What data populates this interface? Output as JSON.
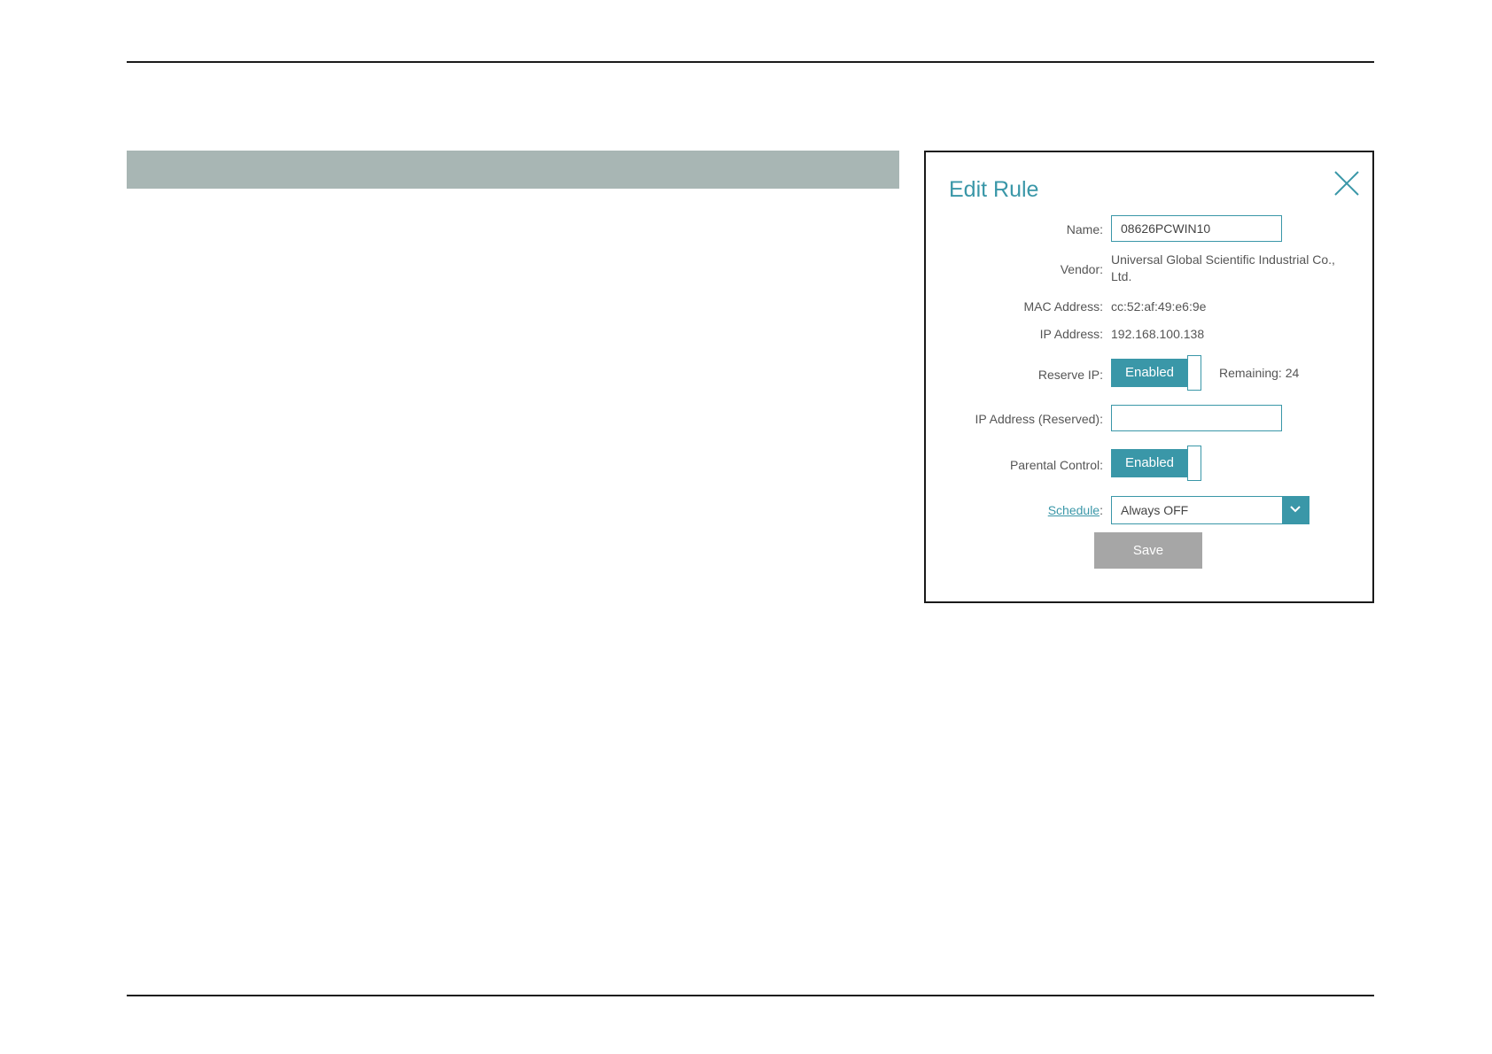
{
  "dialog": {
    "title": "Edit Rule",
    "name": {
      "label": "Name:",
      "value": "08626PCWIN10"
    },
    "vendor": {
      "label": "Vendor:",
      "value_line1": "Universal Global Scientific Industrial Co.,",
      "value_line2": "Ltd."
    },
    "mac": {
      "label": "MAC Address:",
      "value": "cc:52:af:49:e6:9e"
    },
    "ip": {
      "label": "IP Address:",
      "value": "192.168.100.138"
    },
    "reserve_ip": {
      "label": "Reserve IP:",
      "toggle_text": "Enabled",
      "remaining": "Remaining: 24"
    },
    "ip_reserved": {
      "label": "IP Address (Reserved):",
      "value": ""
    },
    "parental_control": {
      "label": "Parental Control:",
      "toggle_text": "Enabled"
    },
    "schedule": {
      "label": "Schedule",
      "label_suffix": ":",
      "selected": "Always OFF"
    },
    "save_label": "Save"
  },
  "colors": {
    "accent": "#3a97a8",
    "section_bar": "#a8b6b4",
    "save_button": "#a6a6a6"
  },
  "icons": {
    "close": "close-icon",
    "dropdown": "chevron-down-icon"
  }
}
